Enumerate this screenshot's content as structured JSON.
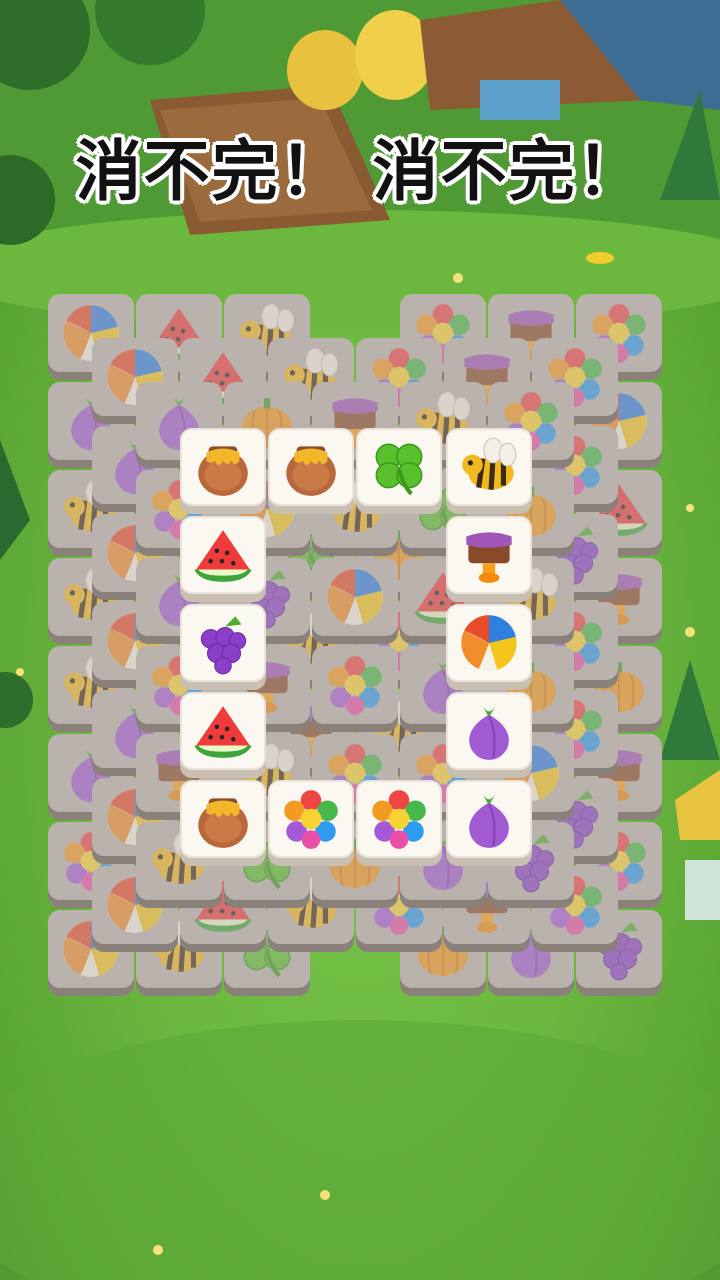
{
  "headline": "消不完！ 消不完！",
  "colors": {
    "grass": "#6cb83f",
    "tile_face": "#fbf8f2",
    "tile_back": "#b9b2ad"
  },
  "tiles_layer1": [
    {
      "icon": "beach-ball-icon"
    },
    {
      "icon": "watermelon-icon"
    },
    {
      "icon": "bee-icon"
    },
    {
      "icon": "flower-icon"
    },
    {
      "icon": "cake-icon"
    },
    {
      "icon": "flower-icon"
    },
    {
      "icon": "onion-icon"
    },
    {
      "icon": "pumpkin-icon"
    },
    {
      "icon": "cake-icon"
    },
    {
      "icon": "bee-icon"
    },
    {
      "icon": "flower-icon"
    },
    {
      "icon": "flower-icon"
    },
    {
      "icon": "beach-ball-icon"
    },
    {
      "icon": "bee-icon"
    },
    {
      "icon": "clover-icon"
    },
    {
      "icon": "pumpkin-icon"
    },
    {
      "icon": "onion-icon"
    },
    {
      "icon": "grapes-icon"
    }
  ],
  "tiles_top": [
    {
      "id": "t1",
      "icon": "honey-pot-icon"
    },
    {
      "id": "t2",
      "icon": "honey-pot-icon"
    },
    {
      "id": "t3",
      "icon": "clover-icon"
    },
    {
      "id": "t4",
      "icon": "bee-icon"
    },
    {
      "id": "t5",
      "icon": "watermelon-icon"
    },
    {
      "id": "t6",
      "icon": "cake-icon"
    },
    {
      "id": "t7",
      "icon": "grapes-icon"
    },
    {
      "id": "t8",
      "icon": "beach-ball-icon"
    },
    {
      "id": "t9",
      "icon": "watermelon-icon"
    },
    {
      "id": "t10",
      "icon": "onion-icon"
    },
    {
      "id": "t11",
      "icon": "honey-pot-icon"
    },
    {
      "id": "t12",
      "icon": "flower-icon"
    },
    {
      "id": "t13",
      "icon": "flower-icon"
    },
    {
      "id": "t14",
      "icon": "onion-icon"
    }
  ]
}
